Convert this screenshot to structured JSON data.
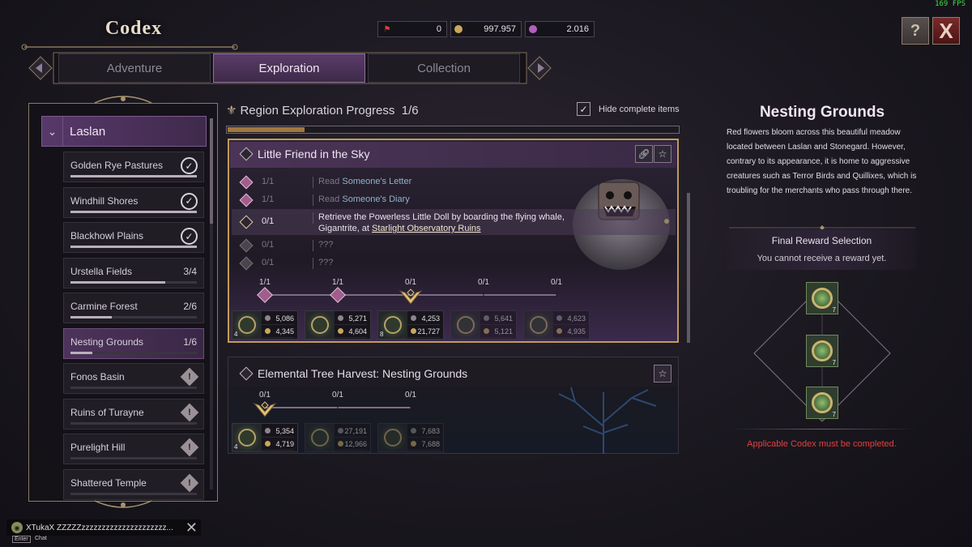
{
  "header": {
    "title": "Codex",
    "fps": "169 FPS",
    "currencies": [
      {
        "icon": "flag-ticket-icon",
        "color": "#d0463a",
        "value": "0"
      },
      {
        "icon": "gold-coin-icon",
        "color": "#c8a85a",
        "value": "997.957"
      },
      {
        "icon": "purple-gem-icon",
        "color": "#b15fc0",
        "value": "2.016"
      }
    ],
    "help_icon": "?",
    "close_icon": "X"
  },
  "tabs": [
    {
      "label": "Adventure",
      "active": false
    },
    {
      "label": "Exploration",
      "active": true
    },
    {
      "label": "Collection",
      "active": false
    }
  ],
  "sidebar": {
    "region": "Laslan",
    "zones": [
      {
        "name": "Golden Rye Pastures",
        "progress": "",
        "state": "complete",
        "fill": 1.0
      },
      {
        "name": "Windhill Shores",
        "progress": "",
        "state": "complete",
        "fill": 1.0
      },
      {
        "name": "Blackhowl Plains",
        "progress": "",
        "state": "complete",
        "fill": 1.0
      },
      {
        "name": "Urstella Fields",
        "progress": "3/4",
        "state": "progress",
        "fill": 0.75
      },
      {
        "name": "Carmine Forest",
        "progress": "2/6",
        "state": "progress",
        "fill": 0.33
      },
      {
        "name": "Nesting Grounds",
        "progress": "1/6",
        "state": "active",
        "fill": 0.17
      },
      {
        "name": "Fonos Basin",
        "progress": "",
        "state": "locked",
        "fill": 0
      },
      {
        "name": "Ruins of Turayne",
        "progress": "",
        "state": "locked",
        "fill": 0
      },
      {
        "name": "Purelight Hill",
        "progress": "",
        "state": "locked",
        "fill": 0
      },
      {
        "name": "Shattered Temple",
        "progress": "",
        "state": "locked",
        "fill": 0
      }
    ],
    "warn_glyph": "!",
    "check_glyph": "✓"
  },
  "main": {
    "progress_title": "Region Exploration Progress",
    "progress_value": "1/6",
    "progress_fill": 0.17,
    "hide_label": "Hide complete items",
    "hide_checked": "✓",
    "quest1": {
      "title": "Little Friend in the Sky",
      "objectives": [
        {
          "count": "1/1",
          "prefix": "Read ",
          "highlight": "Someone's Letter",
          "state": "done"
        },
        {
          "count": "1/1",
          "prefix": "Read ",
          "highlight": "Someone's Diary",
          "state": "done"
        },
        {
          "count": "0/1",
          "line1": "Retrieve the Powerless Little Doll by boarding the flying whale,",
          "line2a": "Gigantrite, at ",
          "line2b": "Starlight Observatory Ruins",
          "state": "current"
        },
        {
          "count": "0/1",
          "text": "???",
          "state": "locked"
        },
        {
          "count": "0/1",
          "text": "???",
          "state": "locked"
        }
      ],
      "milestones": [
        {
          "count": "1/1",
          "state": "done",
          "qty": "4",
          "v1": "5,086",
          "v2": "4,345"
        },
        {
          "count": "1/1",
          "state": "done",
          "qty": "",
          "v1": "5,271",
          "v2": "4,604"
        },
        {
          "count": "0/1",
          "state": "current",
          "qty": "8",
          "v1": "4,253",
          "v2": "21,727"
        },
        {
          "count": "0/1",
          "state": "locked",
          "qty": "",
          "v1": "5,641",
          "v2": "5,121"
        },
        {
          "count": "0/1",
          "state": "locked",
          "qty": "",
          "v1": "4,623",
          "v2": "4,935"
        }
      ]
    },
    "quest2": {
      "title": "Elemental Tree Harvest: Nesting Grounds",
      "milestones": [
        {
          "count": "0/1",
          "state": "current",
          "qty": "4",
          "v1": "5,354",
          "v2": "4,719"
        },
        {
          "count": "0/1",
          "state": "locked",
          "qty": "",
          "v1": "27,191",
          "v2": "12,966"
        },
        {
          "count": "0/1",
          "state": "locked",
          "qty": "",
          "v1": "7,683",
          "v2": "7,688"
        }
      ]
    }
  },
  "detail": {
    "title": "Nesting Grounds",
    "description": "Red flowers bloom across this beautiful meadow located between Laslan and Stonegard. However, contrary to its appearance, it is home to aggressive creatures such as Terror Birds and Quillixes, which is troubling for the merchants who pass through there.",
    "reward_title": "Final Reward Selection",
    "reward_subtitle": "You cannot receive a reward yet.",
    "reward_qty": [
      "7",
      "7",
      "7"
    ],
    "warning": "Applicable Codex must be completed."
  },
  "chat": {
    "user": "XTukaX",
    "message": "ZZZZZzzzzzzzzzzzzzzzzzzzzz...",
    "enter_key": "Enter",
    "label": "Chat"
  },
  "colors": {
    "accent": "#c09b5b",
    "active_purple": "#57386a",
    "warning_red": "#e0413f"
  }
}
